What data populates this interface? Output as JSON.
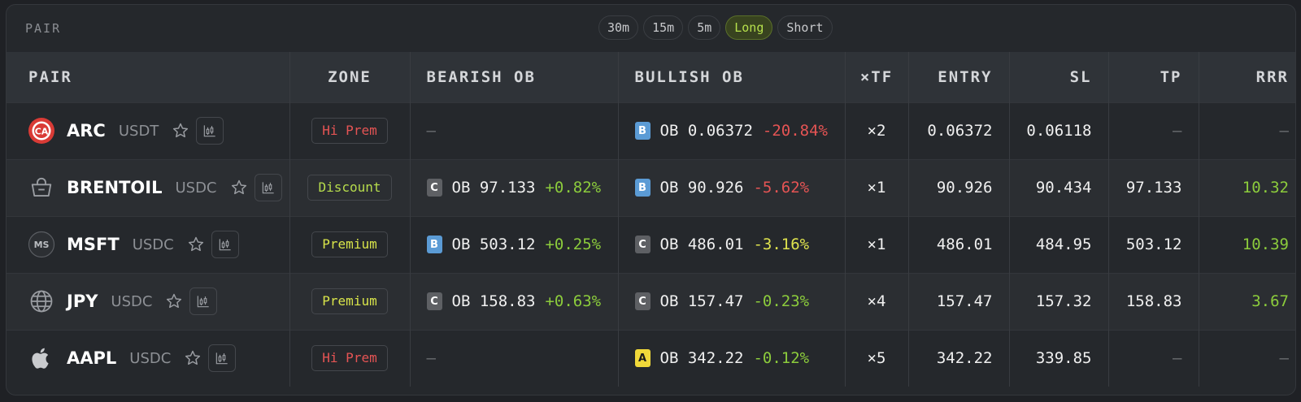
{
  "header": {
    "label": "PAIR",
    "timeframes": [
      "30m",
      "15m",
      "5m"
    ],
    "directions": [
      {
        "label": "Long",
        "active": true
      },
      {
        "label": "Short",
        "active": false
      }
    ]
  },
  "columns": {
    "pair": "PAIR",
    "zone": "ZONE",
    "bearish": "BEARISH OB",
    "bullish": "BULLISH OB",
    "tf": "×TF",
    "entry": "ENTRY",
    "sl": "SL",
    "tp": "TP",
    "rrr": "RRR"
  },
  "colors": {
    "red": "#e55454",
    "green": "#8ccc3c",
    "lime": "#dfe34e",
    "dash": "#6f7276",
    "premium_text": "#d8e44a",
    "discount_text": "#b6dc4c"
  },
  "rows": [
    {
      "icon": "arc-logo-icon",
      "symbol": "ARC",
      "quote": "USDT",
      "zone": "Hi Prem",
      "zone_color": "#e55454",
      "bearish": null,
      "bullish": {
        "tag": "B",
        "text": "OB 0.06372",
        "pct": "-20.84%",
        "pct_color": "#e55454"
      },
      "tf": "×2",
      "entry": "0.06372",
      "sl": "0.06118",
      "tp": "—",
      "rrr": "—",
      "rrr_color": "#6f7276"
    },
    {
      "icon": "shopping-basket-icon",
      "symbol": "BRENTOIL",
      "quote": "USDC",
      "zone": "Discount",
      "zone_color": "#b6dc4c",
      "bearish": {
        "tag": "C",
        "text": "OB 97.133",
        "pct": "+0.82%",
        "pct_color": "#8ccc3c"
      },
      "bullish": {
        "tag": "B",
        "text": "OB 90.926",
        "pct": "-5.62%",
        "pct_color": "#e55454"
      },
      "tf": "×1",
      "entry": "90.926",
      "sl": "90.434",
      "tp": "97.133",
      "rrr": "10.32",
      "rrr_color": "#8ccc3c"
    },
    {
      "icon": "ms-logo-icon",
      "symbol": "MSFT",
      "quote": "USDC",
      "zone": "Premium",
      "zone_color": "#d8e44a",
      "bearish": {
        "tag": "B",
        "text": "OB 503.12",
        "pct": "+0.25%",
        "pct_color": "#8ccc3c"
      },
      "bullish": {
        "tag": "C",
        "text": "OB 486.01",
        "pct": "-3.16%",
        "pct_color": "#dfe34e"
      },
      "tf": "×1",
      "entry": "486.01",
      "sl": "484.95",
      "tp": "503.12",
      "rrr": "10.39",
      "rrr_color": "#8ccc3c"
    },
    {
      "icon": "globe-icon",
      "symbol": "JPY",
      "quote": "USDC",
      "zone": "Premium",
      "zone_color": "#d8e44a",
      "bearish": {
        "tag": "C",
        "text": "OB 158.83",
        "pct": "+0.63%",
        "pct_color": "#8ccc3c"
      },
      "bullish": {
        "tag": "C",
        "text": "OB 157.47",
        "pct": "-0.23%",
        "pct_color": "#8ccc3c"
      },
      "tf": "×4",
      "entry": "157.47",
      "sl": "157.32",
      "tp": "158.83",
      "rrr": "3.67",
      "rrr_color": "#8ccc3c"
    },
    {
      "icon": "apple-icon",
      "symbol": "AAPL",
      "quote": "USDC",
      "zone": "Hi Prem",
      "zone_color": "#e55454",
      "bearish": null,
      "bullish": {
        "tag": "A",
        "text": "OB 342.22",
        "pct": "-0.12%",
        "pct_color": "#8ccc3c"
      },
      "tf": "×5",
      "entry": "342.22",
      "sl": "339.85",
      "tp": "—",
      "rrr": "—",
      "rrr_color": "#6f7276"
    }
  ],
  "empty_dash": "—"
}
